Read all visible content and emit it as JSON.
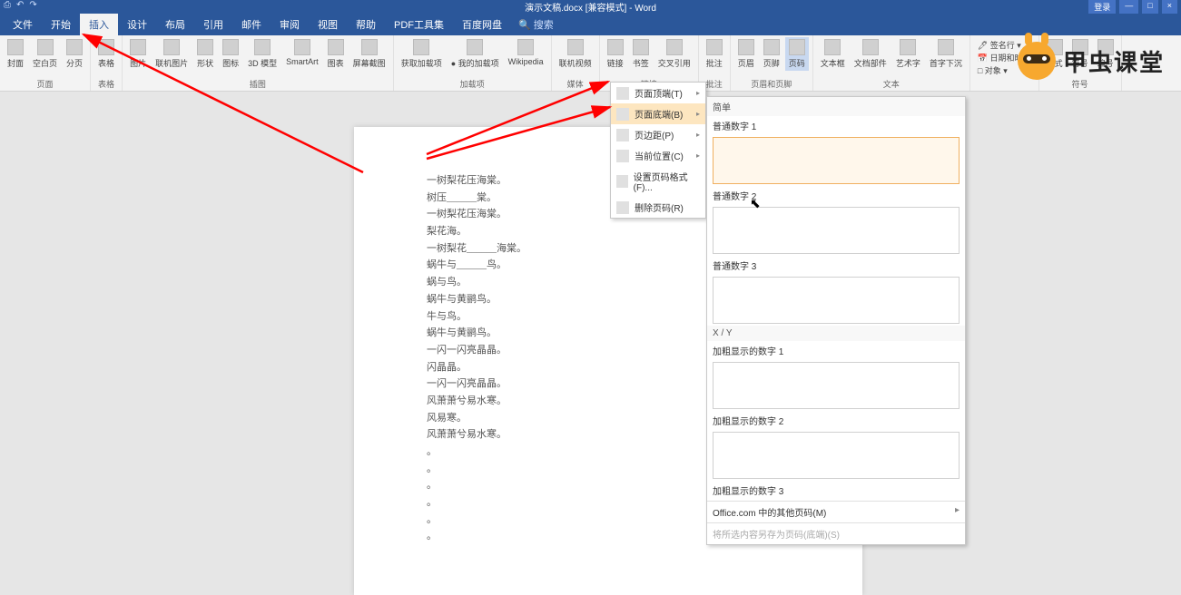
{
  "title": "演示文稿.docx [兼容模式] - Word",
  "win": {
    "login": "登录",
    "min": "—",
    "max": "□",
    "close": "×"
  },
  "quick": [
    "⎙",
    "↶",
    "↷"
  ],
  "menu": {
    "tabs": [
      "文件",
      "开始",
      "插入",
      "设计",
      "布局",
      "引用",
      "邮件",
      "审阅",
      "视图",
      "帮助",
      "PDF工具集",
      "百度网盘"
    ],
    "activeIndex": 2,
    "search": "🔍 搜索"
  },
  "ribbon": {
    "groups": [
      {
        "label": "页面",
        "items": [
          "封面",
          "空白页",
          "分页"
        ]
      },
      {
        "label": "表格",
        "items": [
          "表格"
        ]
      },
      {
        "label": "插图",
        "items": [
          "图片",
          "联机图片",
          "形状",
          "图标",
          "3D 模型",
          "SmartArt",
          "图表",
          "屏幕截图"
        ]
      },
      {
        "label": "加载项",
        "items": [
          "获取加载项",
          "● 我的加载项",
          "Wikipedia"
        ]
      },
      {
        "label": "媒体",
        "items": [
          "联机视频"
        ]
      },
      {
        "label": "链接",
        "items": [
          "链接",
          "书签",
          "交叉引用"
        ]
      },
      {
        "label": "批注",
        "items": [
          "批注"
        ]
      },
      {
        "label": "页眉和页脚",
        "items": [
          "页眉",
          "页脚",
          "页码"
        ],
        "activeIndex": 2
      },
      {
        "label": "文本",
        "items": [
          "文本框",
          "文档部件",
          "艺术字",
          "首字下沉"
        ]
      },
      {
        "label": "",
        "col": [
          "🖊 签名行 ▾",
          "📅 日期和时间",
          "□ 对象 ▾"
        ]
      },
      {
        "label": "符号",
        "items": [
          "公式",
          "符号",
          "编号"
        ]
      }
    ]
  },
  "submenu": {
    "header": "",
    "items": [
      {
        "label": "页面顶端(T)",
        "arrow": true
      },
      {
        "label": "页面底端(B)",
        "arrow": true,
        "hover": true
      },
      {
        "label": "页边距(P)",
        "arrow": true
      },
      {
        "label": "当前位置(C)",
        "arrow": true
      },
      {
        "label": "设置页码格式(F)..."
      },
      {
        "label": "删除页码(R)"
      }
    ]
  },
  "gallery": {
    "sections": [
      {
        "header": "简单",
        "options": [
          {
            "label": "普通数字 1",
            "hover": true
          },
          {
            "label": "普通数字 2"
          },
          {
            "label": "普通数字 3"
          }
        ]
      },
      {
        "header": "X / Y",
        "options": [
          {
            "label": "加粗显示的数字 1"
          },
          {
            "label": "加粗显示的数字 2"
          },
          {
            "label": "加粗显示的数字 3"
          }
        ]
      }
    ],
    "footer1": "Office.com 中的其他页码(M)",
    "footer2": "将所选内容另存为页码(底端)(S)"
  },
  "doc_lines": [
    "一树梨花压海棠。",
    "树压______棠。",
    "一树梨花压海棠。",
    "梨花海。",
    "一树梨花______海棠。",
    "蜗牛与______鸟。",
    "蜗与鸟。",
    "蜗牛与黄鹂鸟。",
    "牛与鸟。",
    "蜗牛与黄鹂鸟。",
    "一闪一闪亮晶晶。",
    "闪晶晶。",
    "一闪一闪亮晶晶。",
    "风萧萧兮易水寒。",
    "风易寒。",
    "风萧萧兮易水寒。",
    "。",
    "。",
    "。",
    "。",
    "。",
    "。"
  ],
  "brand": "甲虫课堂",
  "colors": {
    "accent": "#2b579a",
    "hover": "#fde6c0",
    "arrow": "#ff0000"
  }
}
